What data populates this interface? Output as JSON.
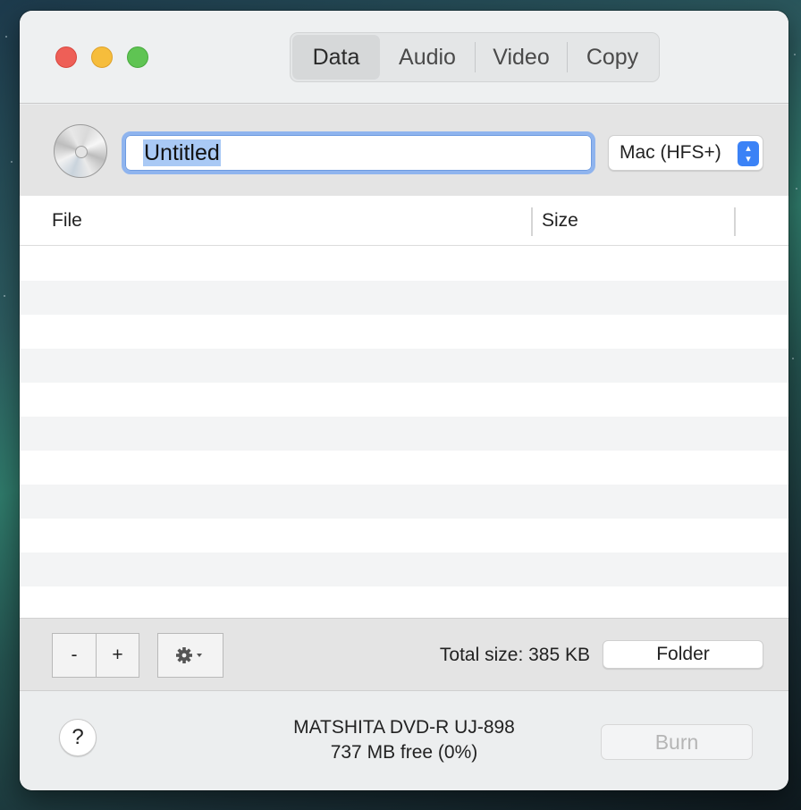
{
  "tabs": [
    {
      "label": "Data",
      "active": true
    },
    {
      "label": "Audio",
      "active": false
    },
    {
      "label": "Video",
      "active": false
    },
    {
      "label": "Copy",
      "active": false
    }
  ],
  "disc": {
    "name_value": "Untitled",
    "filesystem_selected": "Mac (HFS+)"
  },
  "table": {
    "columns": [
      "File",
      "Size"
    ],
    "rows": []
  },
  "toolbar": {
    "remove_label": "-",
    "add_label": "+",
    "total_size": "Total size: 385 KB",
    "folder_label": "Folder"
  },
  "footer": {
    "help_label": "?",
    "drive_name": "MATSHITA DVD-R UJ-898",
    "drive_free": "737 MB free (0%)",
    "burn_label": "Burn"
  },
  "colors": {
    "close": "#ee5f57",
    "minimize": "#f6bd3c",
    "maximize": "#5fc453",
    "accent": "#3b82f6",
    "focus_ring": "#8fb4ee",
    "selection": "#a9c9f5"
  }
}
